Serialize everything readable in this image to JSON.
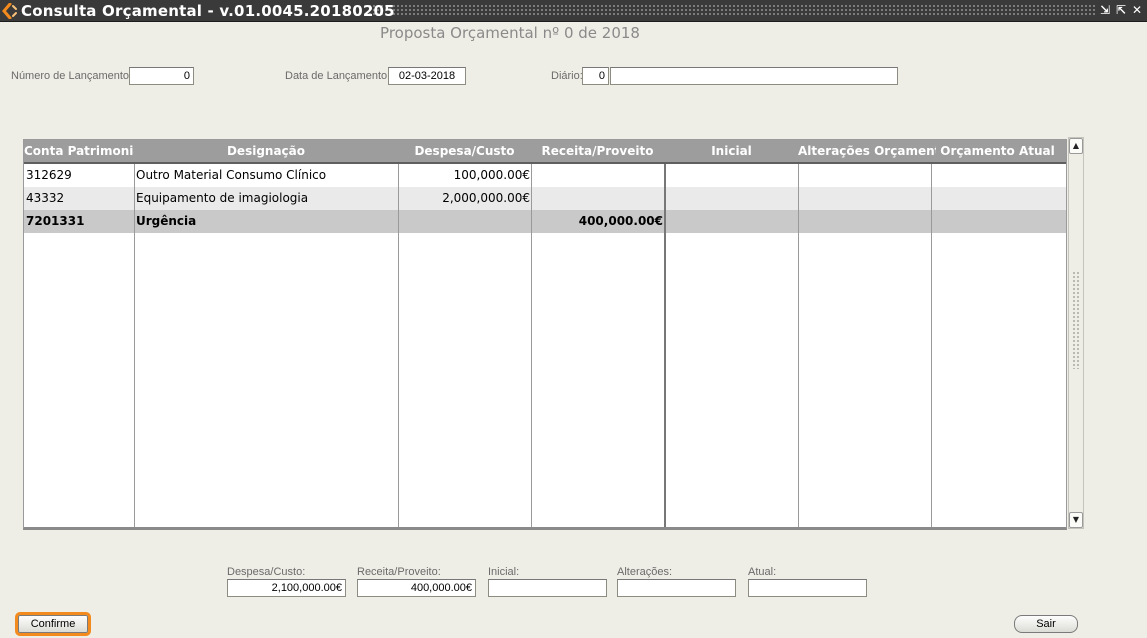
{
  "window": {
    "title": "Consulta Orçamental - v.01.0045.20180205",
    "controls": [
      "⇲",
      "⇱",
      "✕"
    ]
  },
  "heading": "Proposta Orçamental nº 0 de 2018",
  "form": {
    "numero_label": "Número de Lançamento:",
    "numero_value": "0",
    "data_label": "Data de Lançamento:",
    "data_value": "02-03-2018",
    "diario_label": "Diário:",
    "diario_code": "0",
    "diario_desc": ""
  },
  "table": {
    "columns": [
      "Conta Patrimonial",
      "Designação",
      "Despesa/Custo",
      "Receita/Proveito",
      "Inicial",
      "Alterações Orçamentais",
      "Orçamento Atual"
    ],
    "rows": [
      [
        "312629",
        "Outro Material Consumo Clínico",
        "100,000.00€",
        "",
        "",
        "",
        ""
      ],
      [
        "43332",
        "Equipamento de imagiologia",
        "2,000,000.00€",
        "",
        "",
        "",
        ""
      ],
      [
        "7201331",
        "Urgência",
        "",
        "400,000.00€",
        "",
        "",
        ""
      ]
    ],
    "scroll_up_icon": "triangle-up",
    "scroll_down_icon": "triangle-down"
  },
  "totals": {
    "despesa_label": "Despesa/Custo:",
    "despesa_value": "2,100,000.00€",
    "receita_label": "Receita/Proveito:",
    "receita_value": "400,000.00€",
    "inicial_label": "Inicial:",
    "inicial_value": "",
    "alteracoes_label": "Alterações:",
    "alteracoes_value": "",
    "atual_label": "Atual:",
    "atual_value": ""
  },
  "buttons": {
    "confirm": "Confirme",
    "exit": "Sair"
  },
  "colors": {
    "accent": "#f28a1e",
    "titlebar": "#3a3a3a",
    "header": "#9d9d9d",
    "selected_row": "#c9c9c9",
    "alt_row": "#eaeaea"
  }
}
